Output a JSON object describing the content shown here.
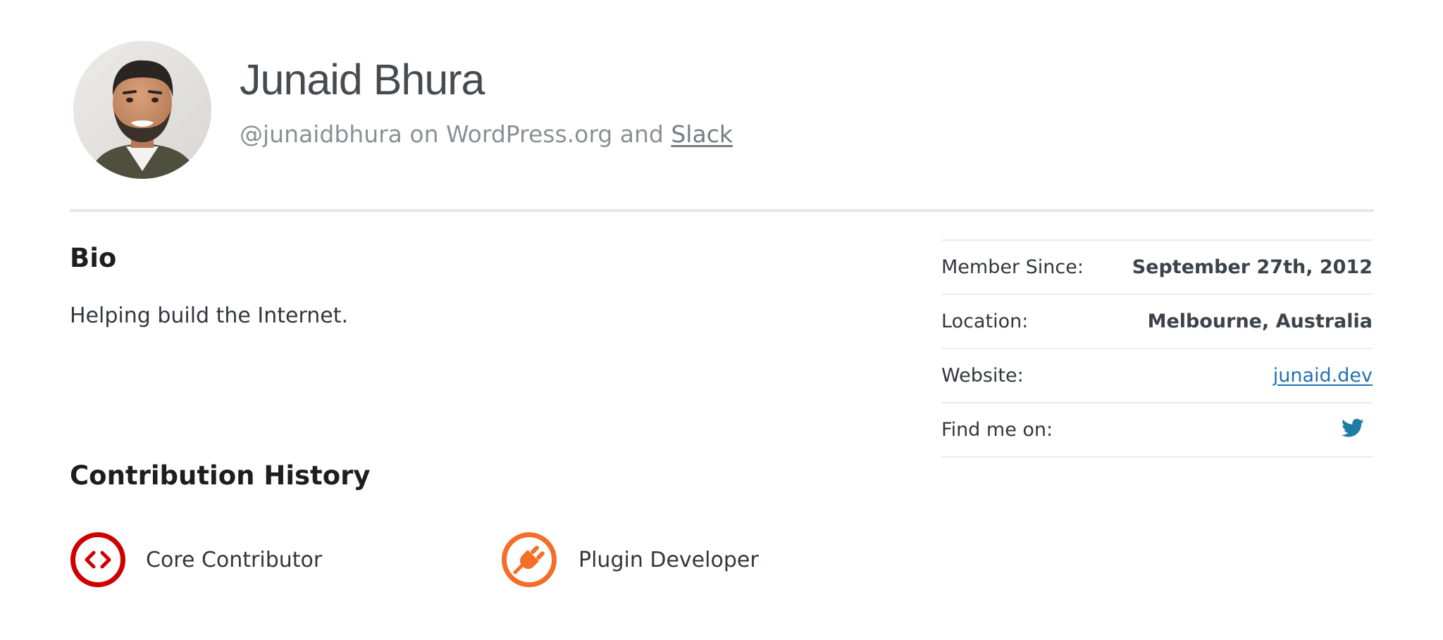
{
  "profile": {
    "name": "Junaid Bhura",
    "handle_text": "@junaidbhura on WordPress.org and",
    "slack_link": "Slack",
    "avatar_icon": "avatar"
  },
  "bio": {
    "title": "Bio",
    "text": "Helping build the Internet."
  },
  "meta": {
    "member_since_label": "Member Since:",
    "member_since_value": "September 27th, 2012",
    "location_label": "Location:",
    "location_value": "Melbourne, Australia",
    "website_label": "Website:",
    "website_value": "junaid.dev",
    "find_me_label": "Find me on:",
    "find_me_icon": "twitter-icon"
  },
  "contributions": {
    "title": "Contribution History",
    "badges": [
      {
        "label": "Core Contributor",
        "icon": "core-contributor-icon",
        "color": "#cf0000"
      },
      {
        "label": "Plugin Developer",
        "icon": "plugin-icon",
        "color": "#f56e28"
      }
    ]
  },
  "colors": {
    "link": "#2271b1",
    "text": "#32373c",
    "muted": "#8c8f94",
    "divider": "#e6e6e6"
  }
}
